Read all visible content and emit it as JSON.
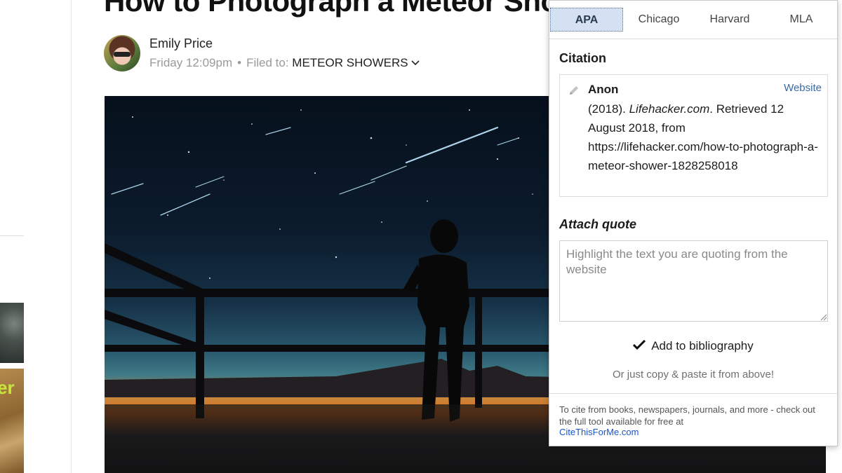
{
  "article": {
    "title": "How to Photograph a Meteor Shower",
    "author": "Emily Price",
    "date": "Friday 12:09pm",
    "dot": "•",
    "filed_label": "Filed to:",
    "filed_tag": "METEOR SHOWERS",
    "chevron": "⌄"
  },
  "rail": {
    "thumb_text": "er"
  },
  "popup": {
    "tabs": [
      {
        "label": "APA",
        "active": true
      },
      {
        "label": "Chicago",
        "active": false
      },
      {
        "label": "Harvard",
        "active": false
      },
      {
        "label": "MLA",
        "active": false
      }
    ],
    "citation_heading": "Citation",
    "citation": {
      "author": "Anon",
      "type_link": "Website",
      "year": "(2018). ",
      "site": "Lifehacker.com",
      "rest": ". Retrieved 12 August 2018, from https://lifehacker.com/how-to-photograph-a-meteor-shower-1828258018"
    },
    "attach_heading": "Attach quote",
    "quote_placeholder": "Highlight the text you are quoting from the website",
    "add_button": "Add to bibliography",
    "copy_hint": "Or just copy & paste it from above!",
    "footer_note": "To cite from books, newspapers, journals, and more - check out the full tool available for free at",
    "footer_link": "CiteThisForMe.com"
  },
  "icons": {
    "pencil": "pencil-icon",
    "check": "check-icon",
    "chevron": "chevron-down-icon"
  },
  "colors": {
    "active_tab_bg": "#d3e1f3",
    "link_blue": "#1a55c8",
    "website_link": "#3b6aa6"
  }
}
